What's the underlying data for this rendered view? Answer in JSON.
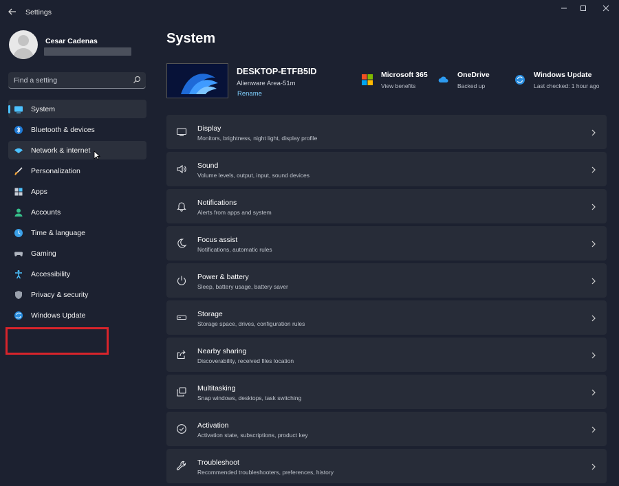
{
  "window": {
    "title": "Settings",
    "back_icon": "back-arrow-icon",
    "controls": [
      "minimize-icon",
      "maximize-icon",
      "close-icon"
    ]
  },
  "user": {
    "name": "Cesar Cadenas",
    "avatar_icon": "user-avatar-icon"
  },
  "search": {
    "placeholder": "Find a setting",
    "icon": "search-icon"
  },
  "sidebar": {
    "items": [
      {
        "label": "System",
        "icon": "system-icon",
        "state": "selected"
      },
      {
        "label": "Bluetooth & devices",
        "icon": "bluetooth-icon"
      },
      {
        "label": "Network & internet",
        "icon": "wifi-icon",
        "state": "hover"
      },
      {
        "label": "Personalization",
        "icon": "brush-icon"
      },
      {
        "label": "Apps",
        "icon": "apps-icon"
      },
      {
        "label": "Accounts",
        "icon": "accounts-icon"
      },
      {
        "label": "Time & language",
        "icon": "globe-clock-icon"
      },
      {
        "label": "Gaming",
        "icon": "controller-icon"
      },
      {
        "label": "Accessibility",
        "icon": "accessibility-icon"
      },
      {
        "label": "Privacy & security",
        "icon": "shield-icon"
      },
      {
        "label": "Windows Update",
        "icon": "update-icon",
        "state": "highlighted"
      }
    ]
  },
  "main": {
    "title": "System",
    "device": {
      "name": "DESKTOP-ETFB5ID",
      "model": "Alienware Area-51m",
      "rename_label": "Rename"
    },
    "quick_links": [
      {
        "title": "Microsoft 365",
        "subtitle": "View benefits",
        "icon": "microsoft-logo-icon"
      },
      {
        "title": "OneDrive",
        "subtitle": "Backed up",
        "icon": "cloud-icon"
      },
      {
        "title": "Windows Update",
        "subtitle": "Last checked: 1 hour ago",
        "icon": "update-icon"
      }
    ],
    "cards": [
      {
        "title": "Display",
        "subtitle": "Monitors, brightness, night light, display profile",
        "icon": "display-icon"
      },
      {
        "title": "Sound",
        "subtitle": "Volume levels, output, input, sound devices",
        "icon": "speaker-icon"
      },
      {
        "title": "Notifications",
        "subtitle": "Alerts from apps and system",
        "icon": "bell-icon"
      },
      {
        "title": "Focus assist",
        "subtitle": "Notifications, automatic rules",
        "icon": "moon-icon"
      },
      {
        "title": "Power & battery",
        "subtitle": "Sleep, battery usage, battery saver",
        "icon": "power-icon"
      },
      {
        "title": "Storage",
        "subtitle": "Storage space, drives, configuration rules",
        "icon": "storage-icon"
      },
      {
        "title": "Nearby sharing",
        "subtitle": "Discoverability, received files location",
        "icon": "share-icon"
      },
      {
        "title": "Multitasking",
        "subtitle": "Snap windows, desktops, task switching",
        "icon": "multitasking-icon"
      },
      {
        "title": "Activation",
        "subtitle": "Activation state, subscriptions, product key",
        "icon": "check-circle-icon"
      },
      {
        "title": "Troubleshoot",
        "subtitle": "Recommended troubleshooters, preferences, history",
        "icon": "wrench-icon"
      }
    ]
  },
  "colors": {
    "background": "#1c2130",
    "card": "#272c38",
    "accent": "#4cc2ff",
    "highlight": "#d8242b"
  }
}
